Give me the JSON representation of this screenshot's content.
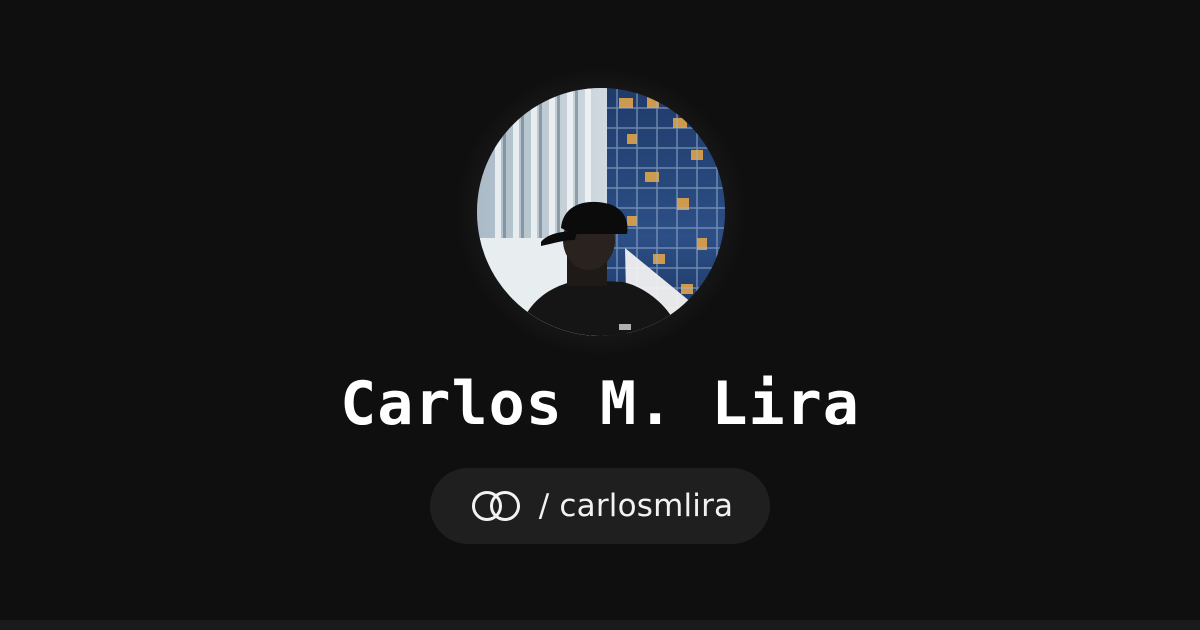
{
  "profile": {
    "name": "Carlos M. Lira",
    "separator": "/",
    "handle": "carlosmlira",
    "avatar_icon": "profile-photo",
    "logo_icon": "interlocked-rings-icon"
  },
  "colors": {
    "background": "#0f0f10",
    "pill_background": "#1f1f20",
    "text": "#ffffff"
  }
}
